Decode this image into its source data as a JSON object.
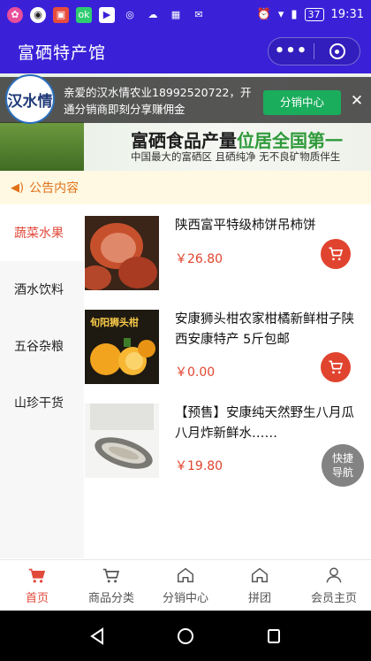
{
  "status_bar": {
    "time": "19:31",
    "battery": "37",
    "left_icons": [
      "notification-icon",
      "qq-icon",
      "image-icon",
      "ok-app-icon",
      "video-icon",
      "weibo-icon",
      "cloud-icon",
      "image-gallery-icon",
      "mail-icon"
    ]
  },
  "header": {
    "title": "富硒特产馆",
    "more": "•••"
  },
  "banner": {
    "headline_part1": "富硒食品产量",
    "headline_part2": "位居全国第一",
    "subline": "中国最大的富硒区 且硒纯净 无不良矿物质伴生"
  },
  "promo": {
    "logo_text": "汉水情",
    "text": "亲爱的汉水情农业18992520722，开通分销商即刻分享赚佣金",
    "button": "分销中心",
    "close": "✕"
  },
  "notice": {
    "label": "公告内容"
  },
  "categories": [
    {
      "label": "蔬菜水果",
      "active": true
    },
    {
      "label": "酒水饮料",
      "active": false
    },
    {
      "label": "五谷杂粮",
      "active": false
    },
    {
      "label": "山珍干货",
      "active": false
    }
  ],
  "products": [
    {
      "name": "陕西富平特级柿饼吊柿饼",
      "price": "￥26.80",
      "image": "dried-persimmon"
    },
    {
      "name": "安康狮头柑农家柑橘新鲜柑子陕西安康特产 5斤包邮",
      "price": "￥0.00",
      "image": "lion-head-orange",
      "image_caption": "旬阳狮头柑"
    },
    {
      "name": "【预售】安康纯天然野生八月瓜八月炸新鲜水……",
      "price": "￥19.80",
      "image": "akebia-fruit"
    }
  ],
  "quick_nav": {
    "line1": "快捷",
    "line2": "导航"
  },
  "tabbar": [
    {
      "label": "首页",
      "icon": "cart-home-icon",
      "active": true
    },
    {
      "label": "商品分类",
      "icon": "cart-icon",
      "active": false
    },
    {
      "label": "分销中心",
      "icon": "home-icon",
      "active": false
    },
    {
      "label": "拼团",
      "icon": "home-icon",
      "active": false
    },
    {
      "label": "会员主页",
      "icon": "user-icon",
      "active": false
    }
  ],
  "colors": {
    "primary": "#3a21d8",
    "accent": "#e14a3b",
    "price": "#e0442f",
    "promo_button": "#1aad5c",
    "notice_text": "#e0721a"
  }
}
